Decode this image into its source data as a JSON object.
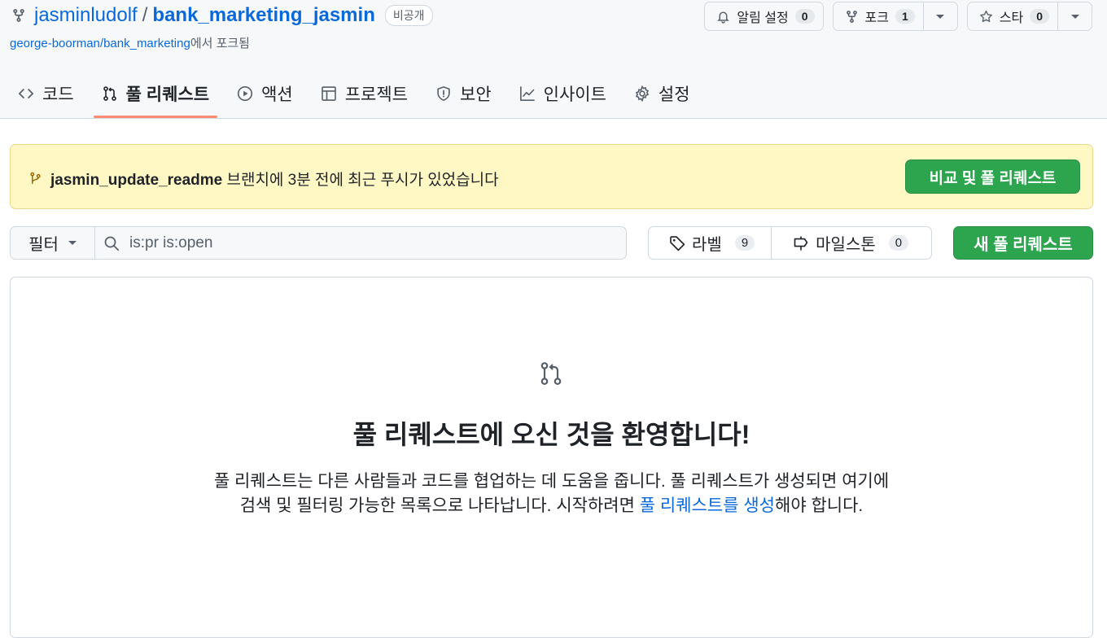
{
  "repo": {
    "owner": "jasminludolf",
    "separator": "/",
    "name": "bank_marketing_jasmin",
    "visibility": "비공개",
    "fork_source": "george-boorman/bank_marketing",
    "fork_suffix": "에서 포크됨"
  },
  "actions": {
    "watch": {
      "label": "알림 설정",
      "count": "0"
    },
    "fork": {
      "label": "포크",
      "count": "1"
    },
    "star": {
      "label": "스타",
      "count": "0"
    }
  },
  "tabs": [
    {
      "label": "코드",
      "icon": "code-icon"
    },
    {
      "label": "풀 리퀘스트",
      "icon": "git-pull-request-icon",
      "active": true
    },
    {
      "label": "액션",
      "icon": "play-icon"
    },
    {
      "label": "프로젝트",
      "icon": "table-icon"
    },
    {
      "label": "보안",
      "icon": "shield-icon"
    },
    {
      "label": "인사이트",
      "icon": "graph-icon"
    },
    {
      "label": "설정",
      "icon": "gear-icon"
    }
  ],
  "banner": {
    "branch": "jasmin_update_readme",
    "message": "브랜치에 3분 전에 최근 푸시가 있었습니다",
    "button": "비교 및 풀 리퀘스트",
    "bg_color": "#fff8c5"
  },
  "toolbar": {
    "filter_label": "필터",
    "search_value": "is:pr is:open",
    "labels": {
      "label": "라벨",
      "count": "9"
    },
    "milestones": {
      "label": "마일스톤",
      "count": "0"
    },
    "new_pr": "새 풀 리퀘스트"
  },
  "blankslate": {
    "title": "풀 리퀘스트에 오신 것을 환영합니다!",
    "line1": "풀 리퀘스트는 다른 사람들과 코드를 협업하는 데 도움을 줍니다. 풀 리퀘스트가 생성되면 여기에",
    "line2_pre": "검색 및 필터링 가능한 목록으로 나타납니다. 시작하려면 ",
    "line2_link": "풀 리퀘스트를 생성",
    "line2_post": "해야 합니다."
  },
  "colors": {
    "link": "#0969da",
    "primary_button": "#2da44e",
    "active_tab_underline": "#fd8c73"
  }
}
